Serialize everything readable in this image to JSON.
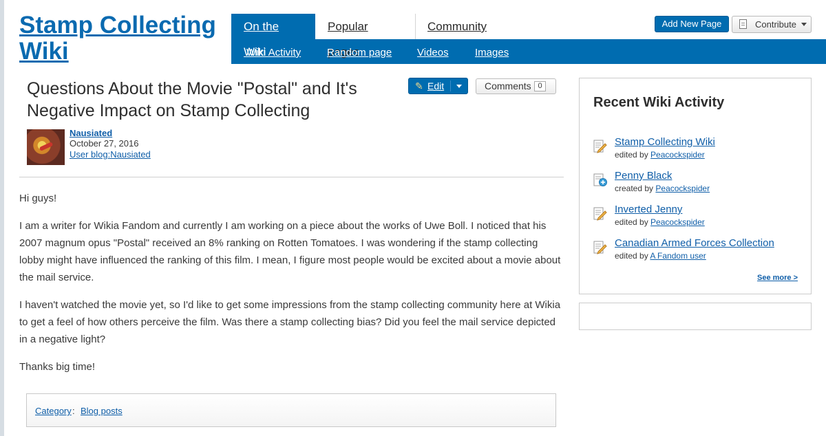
{
  "wiki": {
    "title": "Stamp Collecting Wiki"
  },
  "nav": {
    "tabs": [
      {
        "label": "On the Wiki"
      },
      {
        "label": "Popular pages"
      },
      {
        "label": "Community"
      }
    ],
    "sub_links": [
      {
        "label": "Wiki Activity"
      },
      {
        "label": "Random page"
      },
      {
        "label": "Videos"
      },
      {
        "label": "Images"
      }
    ],
    "add_new_page": "Add New Page",
    "contribute": "Contribute"
  },
  "article": {
    "title": "Questions About the Movie \"Postal\" and It's Negative Impact on Stamp Collecting",
    "edit_label": "Edit",
    "comments_label": "Comments",
    "comments_count": "0",
    "author": "Nausiated",
    "date": "October 27, 2016",
    "blog_link": "User blog:Nausiated",
    "paragraphs": [
      "Hi guys!",
      "I am a writer for Wikia Fandom and currently I am working on a piece about the works of Uwe Boll. I noticed that his 2007 magnum opus \"Postal\" received an 8% ranking on Rotten Tomatoes. I was wondering if the stamp collecting lobby might have influenced the ranking of this film. I mean, I figure most people would be excited about a movie about the mail service.",
      "I haven't watched the movie yet, so I'd like to get some impressions from the stamp collecting community here at Wikia to get a feel of how others perceive the film. Was there a stamp collecting bias? Did you feel the mail service depicted in a negative light?",
      "Thanks big time!"
    ],
    "category_label": "Category",
    "category_value": "Blog posts"
  },
  "rail": {
    "title": "Recent Wiki Activity",
    "items": [
      {
        "title": "Stamp Collecting Wiki",
        "action": "edited by",
        "user": "Peacockspider",
        "icon": "edit-icon"
      },
      {
        "title": "Penny Black",
        "action": "created by",
        "user": "Peacockspider",
        "icon": "new-page-icon"
      },
      {
        "title": "Inverted Jenny",
        "action": "edited by",
        "user": "Peacockspider",
        "icon": "edit-icon"
      },
      {
        "title": "Canadian Armed Forces Collection",
        "action": "edited by",
        "user": "A Fandom user",
        "icon": "edit-icon"
      }
    ],
    "see_more": "See more >"
  },
  "colors": {
    "accent": "#006cb0",
    "link": "#0f5ea8",
    "text": "#3a3a3a"
  }
}
